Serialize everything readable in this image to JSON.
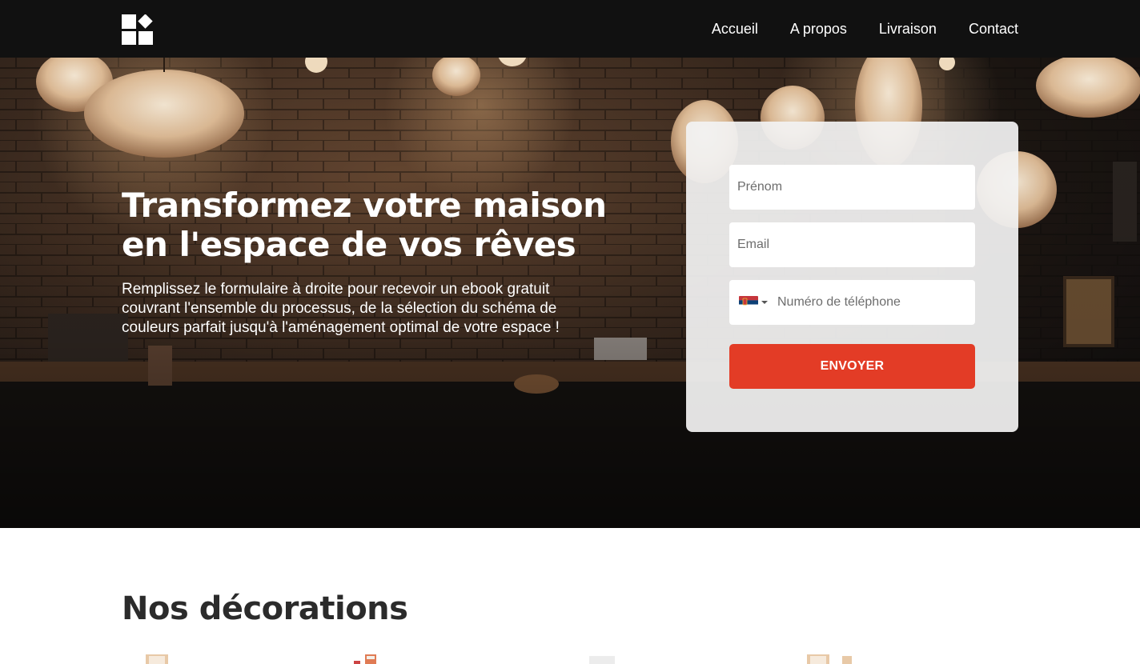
{
  "header": {
    "logo_icon": "blocks-logo-icon",
    "nav": [
      "Accueil",
      "A propos",
      "Livraison",
      "Contact"
    ]
  },
  "hero": {
    "background": "dim restaurant interior with paper lanterns",
    "headline_line1": "Transformez votre maison",
    "headline_line2": "en l'espace de vos rêves",
    "subtext": "Remplissez le formulaire à droite pour recevoir un ebook gratuit couvrant l'ensemble du processus, de la sélection du schéma de couleurs parfait jusqu'à l'aménagement optimal de votre espace !"
  },
  "form": {
    "first_name_placeholder": "Prénom",
    "email_placeholder": "Email",
    "phone_placeholder": "Numéro de téléphone",
    "phone_country_icon": "serbia-flag-icon",
    "submit_label": "ENVOYER",
    "submit_color": "#e33c26"
  },
  "section": {
    "title": "Nos décorations"
  },
  "colors": {
    "header_bg": "#111111",
    "accent": "#e33c26"
  }
}
